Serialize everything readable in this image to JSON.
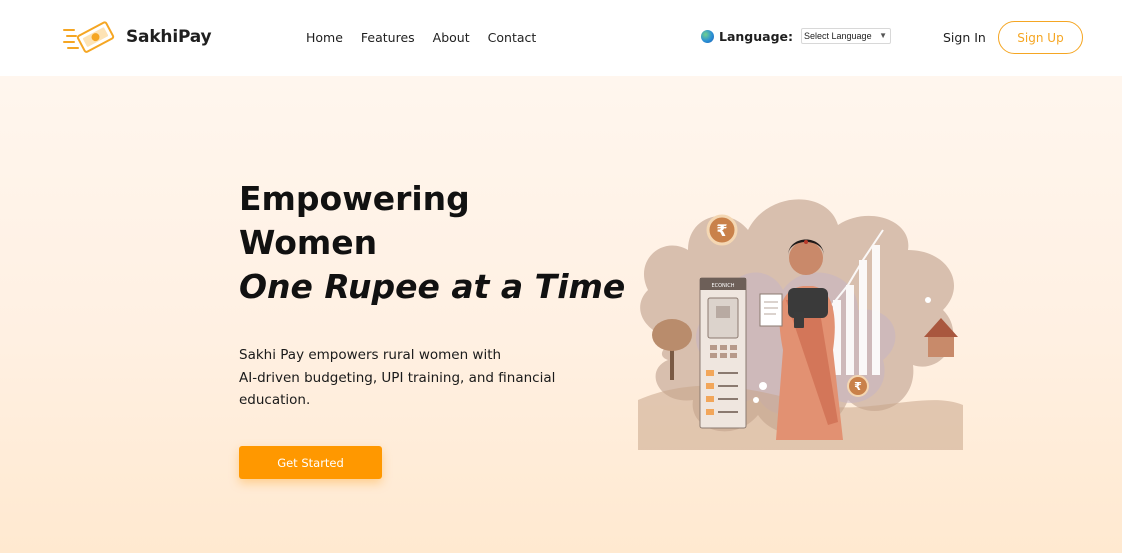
{
  "header": {
    "brand": "SakhiPay",
    "nav": [
      "Home",
      "Features",
      "About",
      "Contact"
    ],
    "language_label": "Language:",
    "language_select": "Select Language",
    "signin": "Sign In",
    "signup": "Sign Up"
  },
  "hero": {
    "title_line1": "Empowering",
    "title_line2": "Women",
    "tagline": "One Rupee at a Time",
    "description_line1": "Sakhi Pay empowers rural women with",
    "description_line2": "AI-driven budgeting, UPI training, and financial",
    "description_line3": "education.",
    "cta": "Get Started",
    "illustration_sign": "ECONICH",
    "rupee_symbol": "₹"
  },
  "colors": {
    "accent": "#ff9800",
    "signup_border": "#f5a623",
    "hero_bg_top": "#fff6ee",
    "hero_bg_bottom": "#ffe9d0"
  },
  "icons": [
    "money-logo-icon",
    "globe-icon",
    "caret-down-icon",
    "rupee-coin-icon"
  ]
}
